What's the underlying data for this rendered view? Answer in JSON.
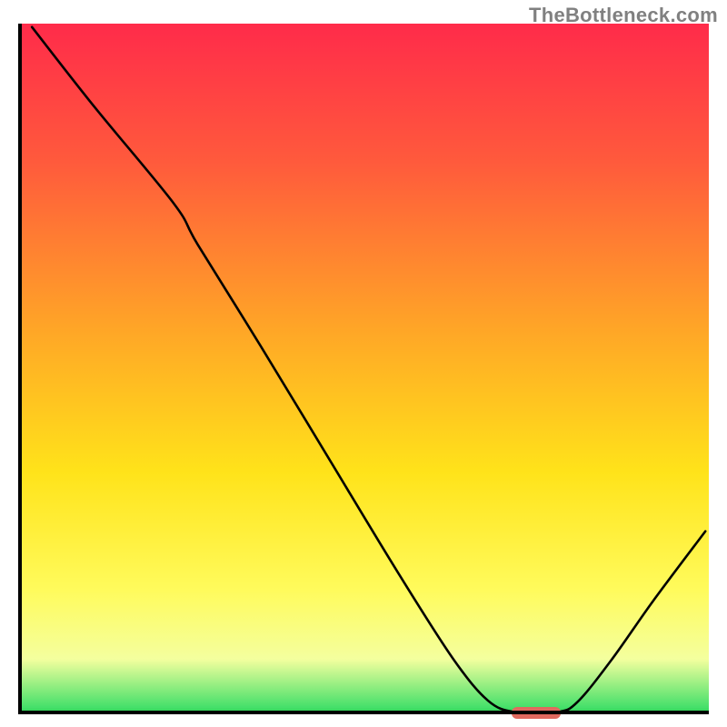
{
  "watermark": "TheBottleneck.com",
  "chart_data": {
    "type": "line",
    "title": "",
    "xlabel": "",
    "ylabel": "",
    "xlim": [
      0,
      100
    ],
    "ylim": [
      0,
      100
    ],
    "gradient_stops": [
      {
        "offset": 0.0,
        "color": "#ff2b4a"
      },
      {
        "offset": 0.2,
        "color": "#ff5a3c"
      },
      {
        "offset": 0.45,
        "color": "#ffa826"
      },
      {
        "offset": 0.65,
        "color": "#ffe31a"
      },
      {
        "offset": 0.82,
        "color": "#fffb5c"
      },
      {
        "offset": 0.92,
        "color": "#f4ff9e"
      },
      {
        "offset": 0.99,
        "color": "#45e06a"
      },
      {
        "offset": 1.0,
        "color": "#2bc94f"
      }
    ],
    "series": [
      {
        "name": "bottleneck-curve",
        "type": "line",
        "color": "#000000",
        "width": 2.6,
        "points": [
          {
            "x": 2.0,
            "y": 99.5
          },
          {
            "x": 11.0,
            "y": 88.0
          },
          {
            "x": 22.5,
            "y": 74.0
          },
          {
            "x": 26.0,
            "y": 68.0
          },
          {
            "x": 35.0,
            "y": 53.5
          },
          {
            "x": 45.0,
            "y": 37.0
          },
          {
            "x": 55.0,
            "y": 20.5
          },
          {
            "x": 63.0,
            "y": 8.0
          },
          {
            "x": 68.0,
            "y": 2.0
          },
          {
            "x": 72.0,
            "y": 0.3
          },
          {
            "x": 78.0,
            "y": 0.3
          },
          {
            "x": 81.0,
            "y": 1.8
          },
          {
            "x": 86.0,
            "y": 8.0
          },
          {
            "x": 92.0,
            "y": 16.5
          },
          {
            "x": 99.5,
            "y": 26.5
          }
        ]
      }
    ],
    "annotations": [
      {
        "name": "min-marker",
        "shape": "rounded-rect",
        "color": "#e0695e",
        "x_center": 75.0,
        "y_center": 0.2,
        "width": 7.0,
        "height": 1.6
      }
    ]
  }
}
